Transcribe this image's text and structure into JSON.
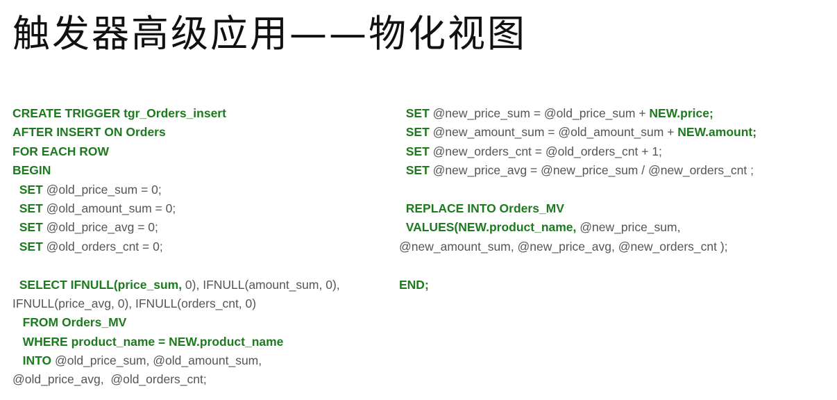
{
  "title": "触发器高级应用——物化视图",
  "code_left": [
    [
      {
        "t": "CREATE TRIGGER tgr_Orders_insert",
        "k": true
      }
    ],
    [
      {
        "t": "AFTER INSERT ON Orders",
        "k": true
      }
    ],
    [
      {
        "t": "FOR EACH ROW",
        "k": true
      }
    ],
    [
      {
        "t": "BEGIN",
        "k": true
      }
    ],
    [
      {
        "t": "  SET",
        "k": true
      },
      {
        "t": " @old_price_sum = 0;",
        "k": false
      }
    ],
    [
      {
        "t": "  SET",
        "k": true
      },
      {
        "t": " @old_amount_sum = 0;",
        "k": false
      }
    ],
    [
      {
        "t": "  SET",
        "k": true
      },
      {
        "t": " @old_price_avg = 0;",
        "k": false
      }
    ],
    [
      {
        "t": "  SET",
        "k": true
      },
      {
        "t": " @old_orders_cnt = 0;",
        "k": false
      }
    ],
    [],
    [
      {
        "t": "  SELECT IFNULL(price_sum,",
        "k": true
      },
      {
        "t": " 0), IFNULL(amount_sum, 0),",
        "k": false
      }
    ],
    [
      {
        "t": "IFNULL(price_avg, 0), IFNULL(orders_cnt, 0)",
        "k": false
      }
    ],
    [
      {
        "t": "   FROM Orders_MV",
        "k": true
      }
    ],
    [
      {
        "t": "   WHERE product_name = NEW.product_name",
        "k": true
      }
    ],
    [
      {
        "t": "   INTO",
        "k": true
      },
      {
        "t": " @old_price_sum, @old_amount_sum,",
        "k": false
      }
    ],
    [
      {
        "t": "@old_price_avg,  @old_orders_cnt;",
        "k": false
      }
    ]
  ],
  "code_right": [
    [
      {
        "t": "  SET",
        "k": true
      },
      {
        "t": " @new_price_sum = @old_price_sum + ",
        "k": false
      },
      {
        "t": "NEW.price;",
        "k": true
      }
    ],
    [
      {
        "t": "  SET",
        "k": true
      },
      {
        "t": " @new_amount_sum = @old_amount_sum + ",
        "k": false
      },
      {
        "t": "NEW.amount;",
        "k": true
      }
    ],
    [
      {
        "t": "  SET",
        "k": true
      },
      {
        "t": " @new_orders_cnt = @old_orders_cnt + 1;",
        "k": false
      }
    ],
    [
      {
        "t": "  SET",
        "k": true
      },
      {
        "t": " @new_price_avg = @new_price_sum / @new_orders_cnt ;",
        "k": false
      }
    ],
    [],
    [
      {
        "t": "  REPLACE INTO Orders_MV",
        "k": true
      }
    ],
    [
      {
        "t": "  VALUES(NEW.product_name,",
        "k": true
      },
      {
        "t": " @new_price_sum,",
        "k": false
      }
    ],
    [
      {
        "t": "@new_amount_sum, @new_price_avg, @new_orders_cnt );",
        "k": false
      }
    ],
    [],
    [
      {
        "t": "END;",
        "k": true
      }
    ]
  ],
  "colors": {
    "keyword": "#1e7a1e",
    "text": "#555555",
    "title": "#111111"
  }
}
